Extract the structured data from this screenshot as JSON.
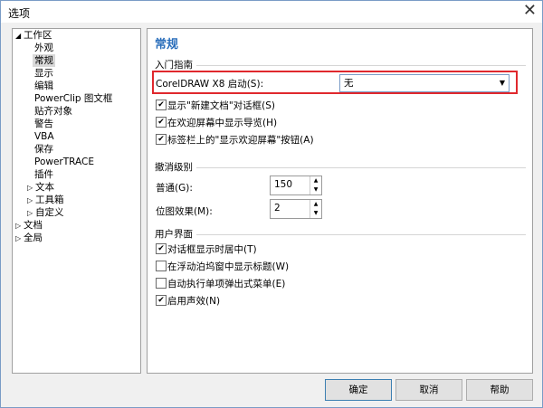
{
  "window": {
    "title": "选项",
    "close_glyph": "✕"
  },
  "tree": {
    "items": [
      {
        "label": "工作区",
        "toggle": "◢"
      },
      {
        "label": "外观"
      },
      {
        "label": "常规"
      },
      {
        "label": "显示"
      },
      {
        "label": "编辑"
      },
      {
        "label": "PowerClip 图文框"
      },
      {
        "label": "贴齐对象"
      },
      {
        "label": "警告"
      },
      {
        "label": "VBA"
      },
      {
        "label": "保存"
      },
      {
        "label": "PowerTRACE"
      },
      {
        "label": "插件"
      },
      {
        "label": "文本",
        "toggle": "▷"
      },
      {
        "label": "工具箱",
        "toggle": "▷"
      },
      {
        "label": "自定义",
        "toggle": "▷"
      },
      {
        "label": "文档",
        "toggle": "▷"
      },
      {
        "label": "全局",
        "toggle": "▷"
      }
    ]
  },
  "main": {
    "title": "常规",
    "intro_section": "入门指南",
    "startup_label": "CorelDRAW X8 启动(S):",
    "startup_value": "无",
    "checks": [
      {
        "label": "显示\"新建文档\"对话框(S)",
        "checked": true
      },
      {
        "label": "在欢迎屏幕中显示导览(H)",
        "checked": true
      },
      {
        "label": "标签栏上的\"显示欢迎屏幕\"按钮(A)",
        "checked": true
      }
    ],
    "undo_section": "撤消级别",
    "normal_label": "普通(G):",
    "normal_value": "150",
    "bitmap_label": "位图效果(M):",
    "bitmap_value": "2",
    "ui_section": "用户界面",
    "ui_checks": [
      {
        "label": "对话框显示时居中(T)",
        "checked": true
      },
      {
        "label": "在浮动泊坞窗中显示标题(W)",
        "checked": false
      },
      {
        "label": "自动执行单项弹出式菜单(E)",
        "checked": false
      },
      {
        "label": "启用声效(N)",
        "checked": true
      }
    ]
  },
  "buttons": {
    "ok": "确定",
    "cancel": "取消",
    "help": "帮助"
  },
  "glyphs": {
    "check": "✔",
    "up": "▲",
    "down": "▼",
    "dropdown": "▼"
  },
  "colors": {
    "accent_title": "#2a6ebb",
    "highlight_border": "#e0282d"
  }
}
